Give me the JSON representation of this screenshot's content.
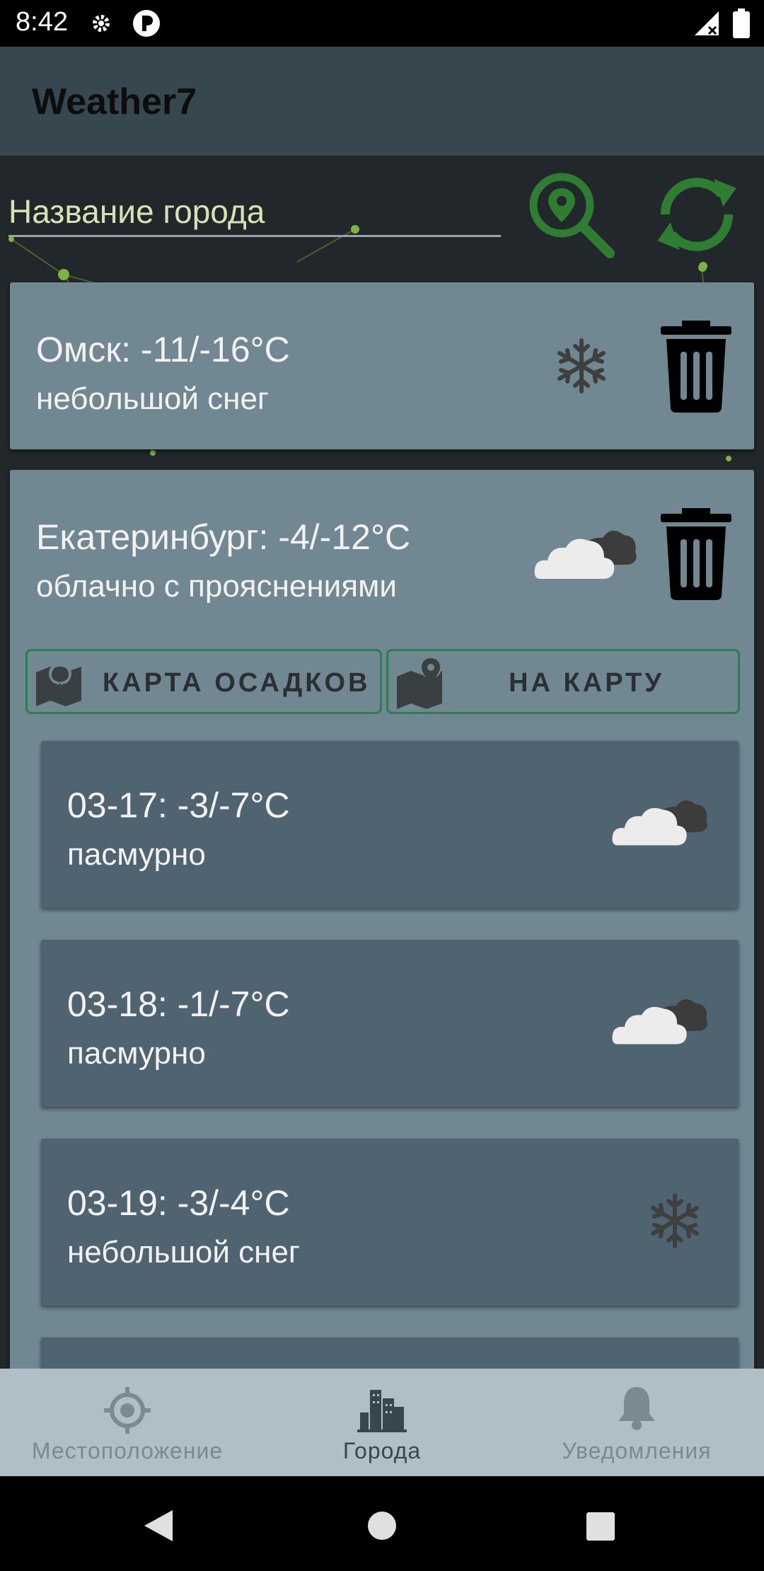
{
  "status_bar": {
    "time": "8:42"
  },
  "app": {
    "title": "Weather7"
  },
  "search": {
    "placeholder": "Название города"
  },
  "cities": [
    {
      "temp": "Омск: -11/-16°C",
      "desc": "небольшой снег",
      "icon": "snowflake-icon"
    },
    {
      "temp": "Екатеринбург: -4/-12°C",
      "desc": "облачно с прояснениями",
      "icon": "cloud-icon",
      "buttons": {
        "precip_map": "КАРТА ОСАДКОВ",
        "to_map": "НА КАРТУ"
      },
      "forecast": [
        {
          "temp": "03-17: -3/-7°C",
          "desc": "пасмурно",
          "icon": "cloud-icon"
        },
        {
          "temp": "03-18: -1/-7°C",
          "desc": "пасмурно",
          "icon": "cloud-icon"
        },
        {
          "temp": "03-19: -3/-4°C",
          "desc": "небольшой снег",
          "icon": "snowflake-icon"
        }
      ]
    }
  ],
  "bottom_nav": {
    "items": [
      {
        "label": "Местоположение",
        "icon": "location-target-icon",
        "active": false
      },
      {
        "label": "Города",
        "icon": "city-icon",
        "active": true
      },
      {
        "label": "Уведомления",
        "icon": "bell-icon",
        "active": false
      }
    ]
  },
  "colors": {
    "accent": "#2e7d32",
    "app_bar": "#37474f",
    "card": "#718792",
    "forecast_card": "#4f6470",
    "bottom_nav": "#b0bec5"
  }
}
